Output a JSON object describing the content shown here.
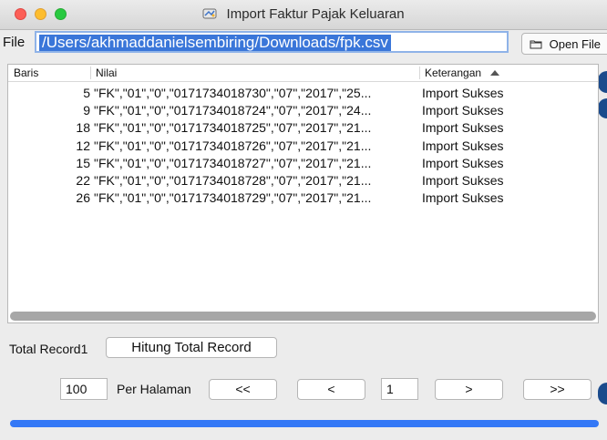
{
  "window": {
    "title": "Import Faktur Pajak Keluaran"
  },
  "file": {
    "label": "File",
    "path": "/Users/akhmaddanielsembiring/Downloads/fpk.csv",
    "open_button_label": "Open File"
  },
  "table": {
    "columns": [
      "Baris",
      "Nilai",
      "Keterangan"
    ],
    "rows": [
      {
        "baris": "5",
        "nilai": "\"FK\",\"01\",\"0\",\"0171734018730\",\"07\",\"2017\",\"25...",
        "keterangan": "Import Sukses"
      },
      {
        "baris": "9",
        "nilai": "\"FK\",\"01\",\"0\",\"0171734018724\",\"07\",\"2017\",\"24...",
        "keterangan": "Import Sukses"
      },
      {
        "baris": "18",
        "nilai": "\"FK\",\"01\",\"0\",\"0171734018725\",\"07\",\"2017\",\"21...",
        "keterangan": "Import Sukses"
      },
      {
        "baris": "12",
        "nilai": "\"FK\",\"01\",\"0\",\"0171734018726\",\"07\",\"2017\",\"21...",
        "keterangan": "Import Sukses"
      },
      {
        "baris": "15",
        "nilai": "\"FK\",\"01\",\"0\",\"0171734018727\",\"07\",\"2017\",\"21...",
        "keterangan": "Import Sukses"
      },
      {
        "baris": "22",
        "nilai": "\"FK\",\"01\",\"0\",\"0171734018728\",\"07\",\"2017\",\"21...",
        "keterangan": "Import Sukses"
      },
      {
        "baris": "26",
        "nilai": "\"FK\",\"01\",\"0\",\"0171734018729\",\"07\",\"2017\",\"21...",
        "keterangan": "Import Sukses"
      }
    ]
  },
  "footer": {
    "total_record_label": "Total Record",
    "total_record_value": "1",
    "hitung_button_label": "Hitung Total Record",
    "per_page_value": "100",
    "per_page_label": "Per Halaman",
    "first_button_label": "<<",
    "prev_button_label": "<",
    "current_page": "1",
    "next_button_label": ">",
    "last_button_label": ">>"
  },
  "colors": {
    "selection": "#3a76d9",
    "progress": "#3478f6",
    "close": "#fc5f57",
    "minimize": "#fdbd2e",
    "maximize": "#28c940"
  },
  "icons": {
    "window_icon": "app-icon",
    "open_file_icon": "folder-icon",
    "sort_icon": "sort-ascending-icon"
  }
}
